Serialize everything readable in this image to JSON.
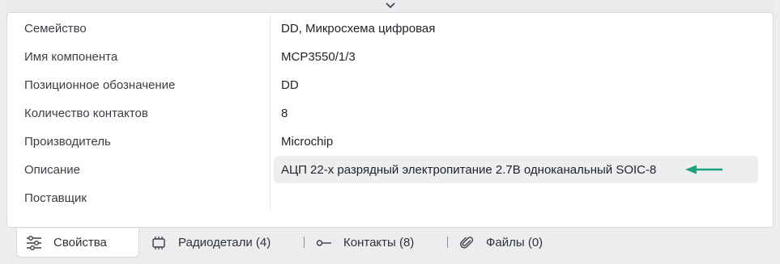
{
  "properties": [
    {
      "label": "Семейство",
      "value": "DD, Микросхема цифровая"
    },
    {
      "label": "Имя компонента",
      "value": "MCP3550/1/3"
    },
    {
      "label": "Позиционное обозначение",
      "value": "DD"
    },
    {
      "label": "Количество контактов",
      "value": "8"
    },
    {
      "label": "Производитель",
      "value": "Microchip"
    },
    {
      "label": "Описание",
      "value": "АЦП 22-х разрядный электропитание 2.7В одноканальный SOIC-8"
    },
    {
      "label": "Поставщик",
      "value": ""
    }
  ],
  "tabs": [
    {
      "label": "Свойства",
      "icon": "sliders-icon",
      "active": true
    },
    {
      "label": "Радиодетали (4)",
      "icon": "chip-icon",
      "active": false
    },
    {
      "label": "Контакты (8)",
      "icon": "pin-icon",
      "active": false
    },
    {
      "label": "Файлы (0)",
      "icon": "paperclip-icon",
      "active": false
    }
  ],
  "colors": {
    "accent_arrow": "#1aa37a",
    "highlight_bg": "#eceef0",
    "panel_bg": "#ffffff",
    "page_bg": "#ebedef"
  }
}
